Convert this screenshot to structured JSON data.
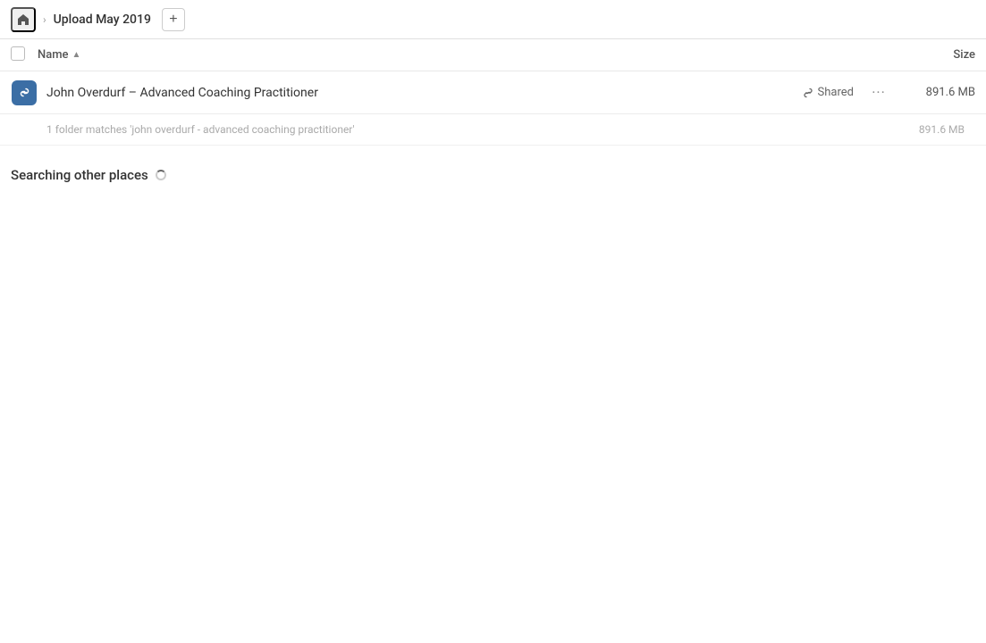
{
  "header": {
    "home_title": "Home",
    "breadcrumb_title": "Upload May 2019",
    "add_button_label": "+"
  },
  "columns": {
    "checkbox_label": "",
    "name_label": "Name",
    "sort_indicator": "▲",
    "size_label": "Size"
  },
  "results": [
    {
      "id": "folder-1",
      "name": "John Overdurf – Advanced Coaching Practitioner",
      "shared": true,
      "shared_label": "Shared",
      "size": "891.6 MB",
      "icon_type": "link-folder"
    }
  ],
  "match_info": {
    "text": "1 folder matches 'john overdurf - advanced coaching practitioner'",
    "size": "891.6 MB"
  },
  "searching_section": {
    "label": "Searching other places"
  },
  "icons": {
    "home": "🏠",
    "chevron_right": "›",
    "link": "🔗",
    "shared": "🔗",
    "more": "•••"
  }
}
